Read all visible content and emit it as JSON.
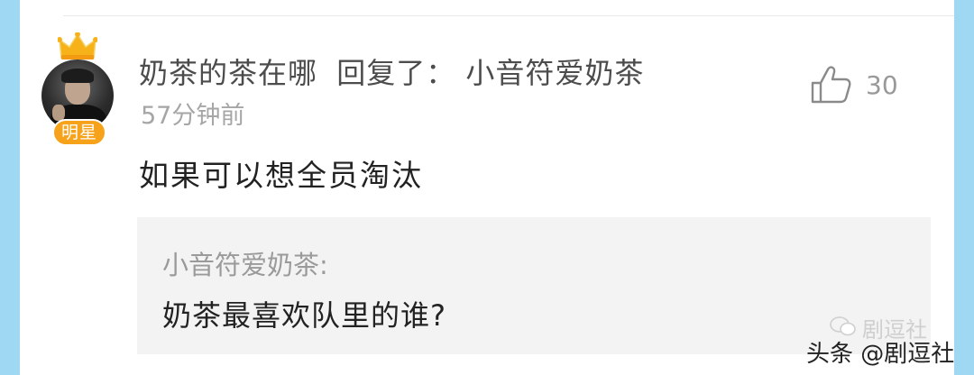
{
  "comment": {
    "author": "奶茶的茶在哪",
    "reply_action": "回复了：",
    "reply_target": "小音符爱奶茶",
    "timestamp": "57分钟前",
    "badge": "明星",
    "text": "如果可以想全员淘汰",
    "like_count": "30"
  },
  "quoted": {
    "author": "小音符爱奶茶:",
    "text": "奶茶最喜欢队里的谁?"
  },
  "watermarks": {
    "wechat": "剧逗社",
    "toutiao": "头条 @剧逗社"
  },
  "colors": {
    "page_bg": "#9fd8f3",
    "badge": "#f6a21a",
    "quote_bg": "#f3f3f3"
  }
}
